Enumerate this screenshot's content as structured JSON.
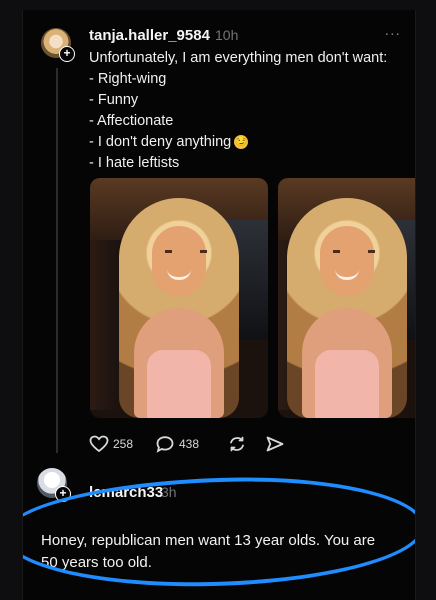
{
  "post": {
    "username": "tanja.haller_9584",
    "time": "10h",
    "menu": "...",
    "lines": [
      "Unfortunately, I am everything men don't want:",
      "- Right-wing",
      "- Funny",
      "- Affectionate",
      "- I don't deny anything",
      "- I hate leftists"
    ],
    "emoji": "😏",
    "stats": {
      "likes": "258",
      "comments": "438"
    }
  },
  "reply": {
    "username": "lcmarch33",
    "time": "3h",
    "text": "Honey, republican men want 13 year olds. You are 50 years too old."
  },
  "icons": {
    "like": "heart-icon",
    "comment": "comment-icon",
    "repost": "repost-icon",
    "share": "share-icon",
    "follow": "plus-icon"
  },
  "colors": {
    "highlight": "#1f8cff",
    "background": "#050505",
    "text": "#f2f2f2",
    "muted": "#747474"
  }
}
